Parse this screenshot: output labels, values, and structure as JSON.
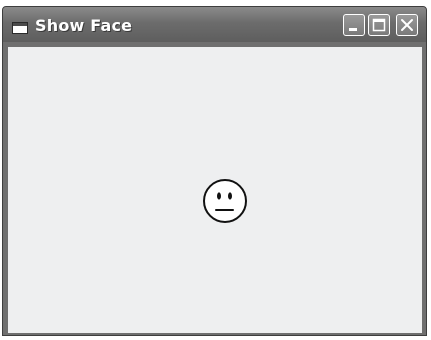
{
  "window": {
    "title": "Show Face",
    "controls": {
      "minimize": "minimize",
      "maximize": "maximize",
      "close": "close"
    }
  },
  "icons": {
    "app": "window-app-icon",
    "minimize": "minimize-icon",
    "maximize": "maximize-icon",
    "close": "close-icon",
    "face": "neutral-face-icon"
  },
  "colors": {
    "titlebar": "#6c6c6c",
    "client": "#eeeff0",
    "face_stroke": "#111111"
  }
}
